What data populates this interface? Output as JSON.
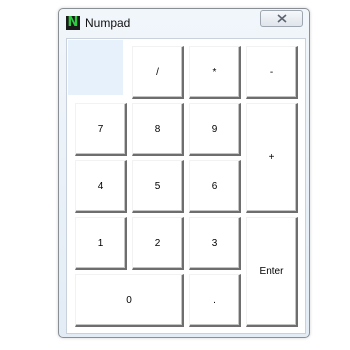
{
  "window": {
    "title": "Numpad",
    "icon_letter": "N"
  },
  "keys": {
    "divide": "/",
    "multiply": "*",
    "minus": "-",
    "seven": "7",
    "eight": "8",
    "nine": "9",
    "plus": "+",
    "four": "4",
    "five": "5",
    "six": "6",
    "one": "1",
    "two": "2",
    "three": "3",
    "enter": "Enter",
    "zero": "0",
    "decimal": "."
  },
  "colors": {
    "icon_green": "#2ecc40",
    "window_frame": "#e3ecf5"
  }
}
